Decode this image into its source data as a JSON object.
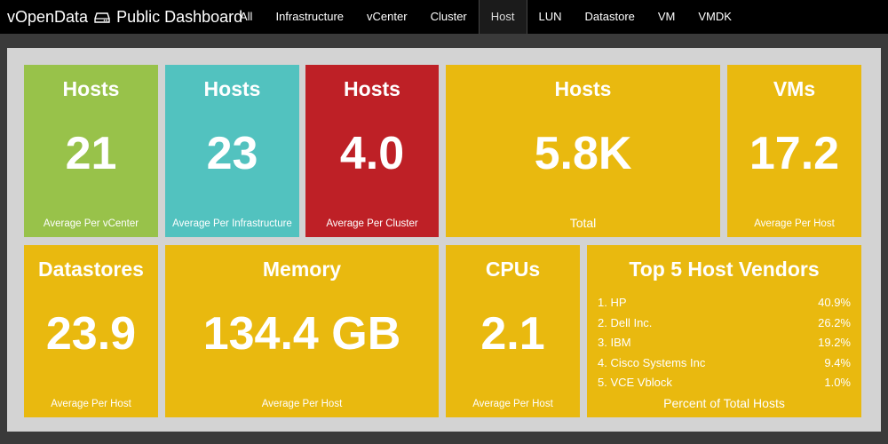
{
  "brand": {
    "title_left": "vOpenData",
    "title_right": "Public Dashboard"
  },
  "nav": {
    "items": [
      "All",
      "Infrastructure",
      "vCenter",
      "Cluster",
      "Host",
      "LUN",
      "Datastore",
      "VM",
      "VMDK"
    ],
    "active": "Host"
  },
  "colors": {
    "green": "#98c24a",
    "teal": "#52c2bf",
    "red": "#be2026",
    "yellow": "#e9b90f",
    "panel": "#d3d3d3"
  },
  "tiles": {
    "hosts_per_vcenter": {
      "title": "Hosts",
      "value": "21",
      "subtitle": "Average Per vCenter"
    },
    "hosts_per_infra": {
      "title": "Hosts",
      "value": "23",
      "subtitle": "Average Per Infrastructure"
    },
    "hosts_per_cluster": {
      "title": "Hosts",
      "value": "4.0",
      "subtitle": "Average Per Cluster"
    },
    "hosts_total": {
      "title": "Hosts",
      "value": "5.8K",
      "subtitle": "Total"
    },
    "vms_per_host": {
      "title": "VMs",
      "value": "17.2",
      "subtitle": "Average Per Host"
    },
    "datastores_per_host": {
      "title": "Datastores",
      "value": "23.9",
      "subtitle": "Average Per Host"
    },
    "memory_per_host": {
      "title": "Memory",
      "value": "134.4 GB",
      "subtitle": "Average Per Host"
    },
    "cpus_per_host": {
      "title": "CPUs",
      "value": "2.1",
      "subtitle": "Average Per Host"
    }
  },
  "vendors": {
    "title": "Top 5 Host Vendors",
    "subtitle": "Percent of Total Hosts",
    "items": [
      {
        "name": "1. HP",
        "percent": "40.9%"
      },
      {
        "name": "2. Dell Inc.",
        "percent": "26.2%"
      },
      {
        "name": "3. IBM",
        "percent": "19.2%"
      },
      {
        "name": "4. Cisco Systems Inc",
        "percent": "9.4%"
      },
      {
        "name": "5. VCE Vblock",
        "percent": "1.0%"
      }
    ]
  }
}
